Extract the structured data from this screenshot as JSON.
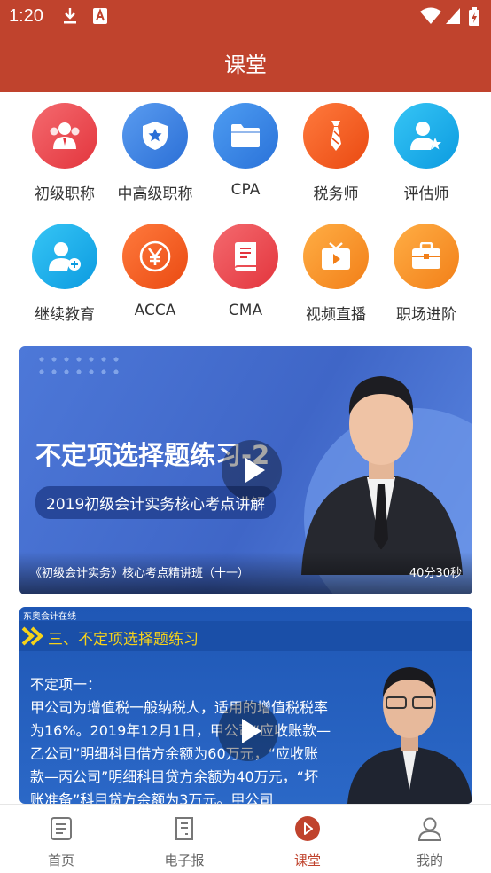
{
  "status_bar": {
    "time": "1:20"
  },
  "header": {
    "title": "课堂"
  },
  "categories": [
    {
      "label": "初级职称",
      "icon": "people-icon",
      "color": "#e8434a"
    },
    {
      "label": "中高级职称",
      "icon": "shield-star-icon",
      "color": "#3b7de0"
    },
    {
      "label": "CPA",
      "icon": "folder-icon",
      "color": "#2f80e3"
    },
    {
      "label": "税务师",
      "icon": "tie-icon",
      "color": "#f2561d"
    },
    {
      "label": "评估师",
      "icon": "user-star-icon",
      "color": "#17aee8"
    },
    {
      "label": "继续教育",
      "icon": "user-plus-icon",
      "color": "#17aee8"
    },
    {
      "label": "ACCA",
      "icon": "yen-icon",
      "color": "#f2561d"
    },
    {
      "label": "CMA",
      "icon": "book-icon",
      "color": "#e8434a"
    },
    {
      "label": "视频直播",
      "icon": "tv-play-icon",
      "color": "#f28a22"
    },
    {
      "label": "职场进阶",
      "icon": "briefcase-icon",
      "color": "#f28a22"
    }
  ],
  "video_1": {
    "banner_title": "不定项选择题练习-2",
    "banner_subtitle": "2019初级会计实务核心考点讲解",
    "caption": "《初级会计实务》核心考点精讲班（十一）",
    "duration": "40分30秒"
  },
  "video_2": {
    "brand": "东奥会计在线",
    "heading": "三、不定项选择题练习",
    "lines": [
      "不定项一：",
      "甲公司为增值税一般纳税人，适用的增值税税率",
      "为16%。2019年12月1日，甲公司“应收账款—",
      "乙公司”明细科目借方余额为60万元，“应收账",
      "款—丙公司”明细科目贷方余额为40万元，“坏",
      "账准备”科目贷方余额为3万元。甲公司"
    ]
  },
  "bottom_nav": [
    {
      "label": "首页",
      "icon": "home-doc-icon",
      "active": false
    },
    {
      "label": "电子报",
      "icon": "newspaper-icon",
      "active": false
    },
    {
      "label": "课堂",
      "icon": "play-circle-icon",
      "active": true
    },
    {
      "label": "我的",
      "icon": "user-icon",
      "active": false
    }
  ],
  "colors": {
    "brand_red": "#c0432d",
    "nav_inactive": "#666666"
  }
}
